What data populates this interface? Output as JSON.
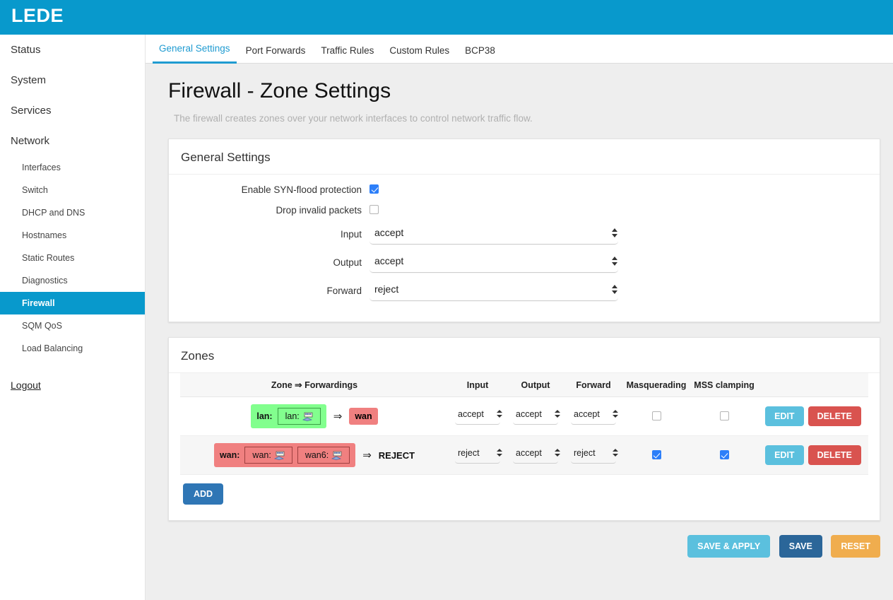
{
  "brand": "LEDE",
  "sidebar": {
    "top_items": [
      {
        "label": "Status"
      },
      {
        "label": "System"
      },
      {
        "label": "Services"
      },
      {
        "label": "Network"
      }
    ],
    "sub_items": [
      {
        "label": "Interfaces",
        "active": false
      },
      {
        "label": "Switch",
        "active": false
      },
      {
        "label": "DHCP and DNS",
        "active": false
      },
      {
        "label": "Hostnames",
        "active": false
      },
      {
        "label": "Static Routes",
        "active": false
      },
      {
        "label": "Diagnostics",
        "active": false
      },
      {
        "label": "Firewall",
        "active": true
      },
      {
        "label": "SQM QoS",
        "active": false
      },
      {
        "label": "Load Balancing",
        "active": false
      }
    ],
    "logout": "Logout"
  },
  "tabs": [
    {
      "label": "General Settings",
      "active": true
    },
    {
      "label": "Port Forwards",
      "active": false
    },
    {
      "label": "Traffic Rules",
      "active": false
    },
    {
      "label": "Custom Rules",
      "active": false
    },
    {
      "label": "BCP38",
      "active": false
    }
  ],
  "page": {
    "title": "Firewall - Zone Settings",
    "description": "The firewall creates zones over your network interfaces to control network traffic flow."
  },
  "general_settings": {
    "panel_title": "General Settings",
    "syn_flood": {
      "label": "Enable SYN-flood protection",
      "checked": true
    },
    "drop_invalid": {
      "label": "Drop invalid packets",
      "checked": false
    },
    "input": {
      "label": "Input",
      "value": "accept"
    },
    "output": {
      "label": "Output",
      "value": "accept"
    },
    "forward": {
      "label": "Forward",
      "value": "reject"
    }
  },
  "zones": {
    "panel_title": "Zones",
    "columns": [
      "Zone ⇒ Forwardings",
      "Input",
      "Output",
      "Forward",
      "Masquerading",
      "MSS clamping"
    ],
    "rows": [
      {
        "zone_name": "lan:",
        "color": "green",
        "interfaces": [
          "lan:"
        ],
        "arrow": "⇒",
        "forward_target": "wan",
        "forward_target_style": "badge-red",
        "input": "accept",
        "output": "accept",
        "forward": "accept",
        "masquerading": false,
        "mss_clamping": false,
        "edit_label": "EDIT",
        "delete_label": "DELETE"
      },
      {
        "zone_name": "wan:",
        "color": "red",
        "interfaces": [
          "wan:",
          "wan6:"
        ],
        "arrow": "⇒",
        "forward_target": "REJECT",
        "forward_target_style": "plain",
        "input": "reject",
        "output": "accept",
        "forward": "reject",
        "masquerading": true,
        "mss_clamping": true,
        "edit_label": "EDIT",
        "delete_label": "DELETE"
      }
    ],
    "add_label": "ADD"
  },
  "footer": {
    "save_apply": "SAVE & APPLY",
    "save": "SAVE",
    "reset": "RESET"
  },
  "colors": {
    "brand_blue": "#0899cc",
    "tab_active": "#1f9bd1",
    "zone_green": "#82ff8e",
    "zone_red": "#f08080",
    "checkbox_on": "#2d7ff9",
    "edit_blue": "#5bc0de",
    "delete_red": "#d9534f",
    "add_blue": "#2f76b5",
    "save_blue": "#2b6699",
    "reset_orange": "#f0ad4e"
  }
}
